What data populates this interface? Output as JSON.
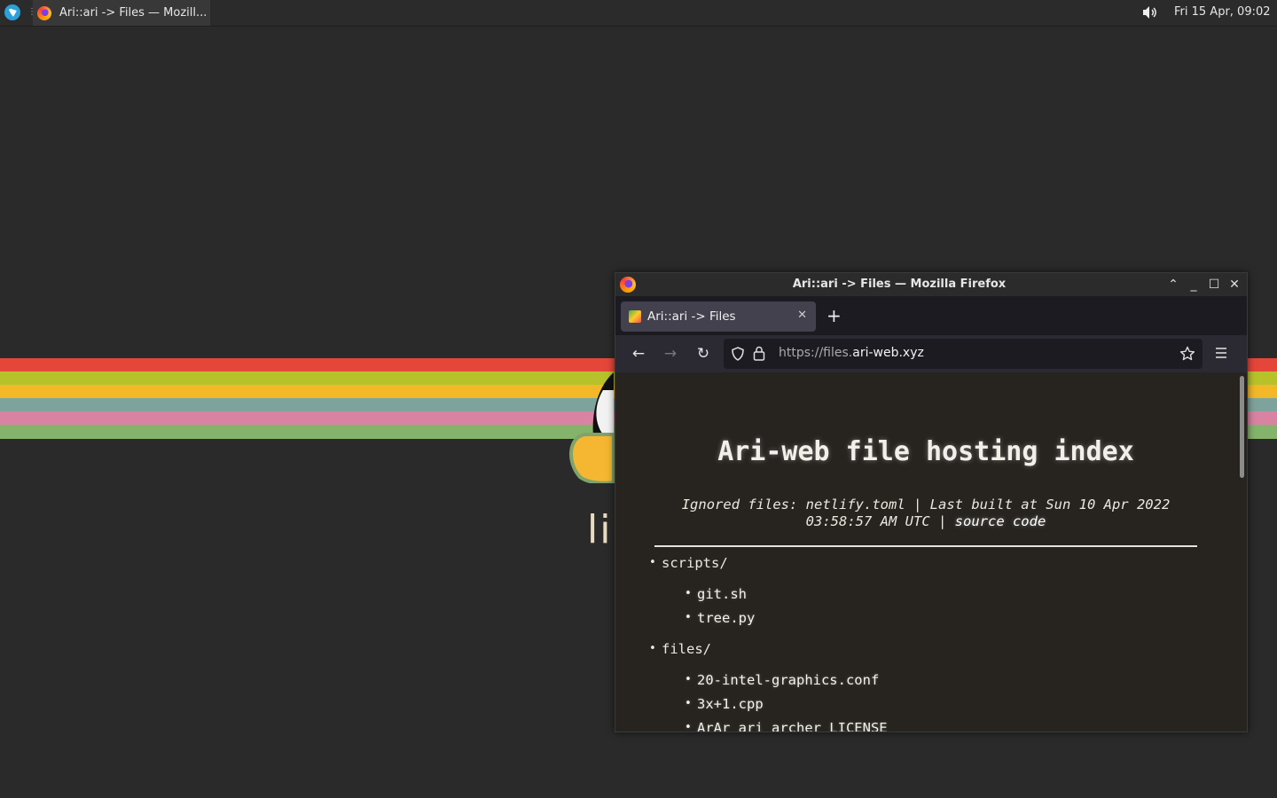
{
  "panel": {
    "taskbar_title": "Ari::ari -> Files — Mozill...",
    "clock": "Fri 15 Apr, 09:02"
  },
  "wallpaper": {
    "stripe_colors": [
      "#e5463a",
      "#b7c22b",
      "#f2b827",
      "#7ea39c",
      "#d983a2",
      "#84b46c"
    ],
    "text": "li"
  },
  "window": {
    "title": "Ari::ari -> Files — Mozilla Firefox",
    "tab_title": "Ari::ari -> Files",
    "url_prefix": "https://files.",
    "url_domain": "ari-web.xyz"
  },
  "page": {
    "heading": "Ari-web file hosting index",
    "subtitle_text": "Ignored files: netlify.toml | Last built at Sun 10 Apr 2022 03:58:57 AM UTC | ",
    "source_link": "source code",
    "tree": [
      {
        "name": "scripts/",
        "children": [
          "git.sh",
          "tree.py"
        ]
      },
      {
        "name": "files/",
        "children": [
          "20-intel-graphics.conf",
          "3x+1.cpp",
          "ArAr_ari_archer_LICENSE"
        ]
      }
    ]
  }
}
